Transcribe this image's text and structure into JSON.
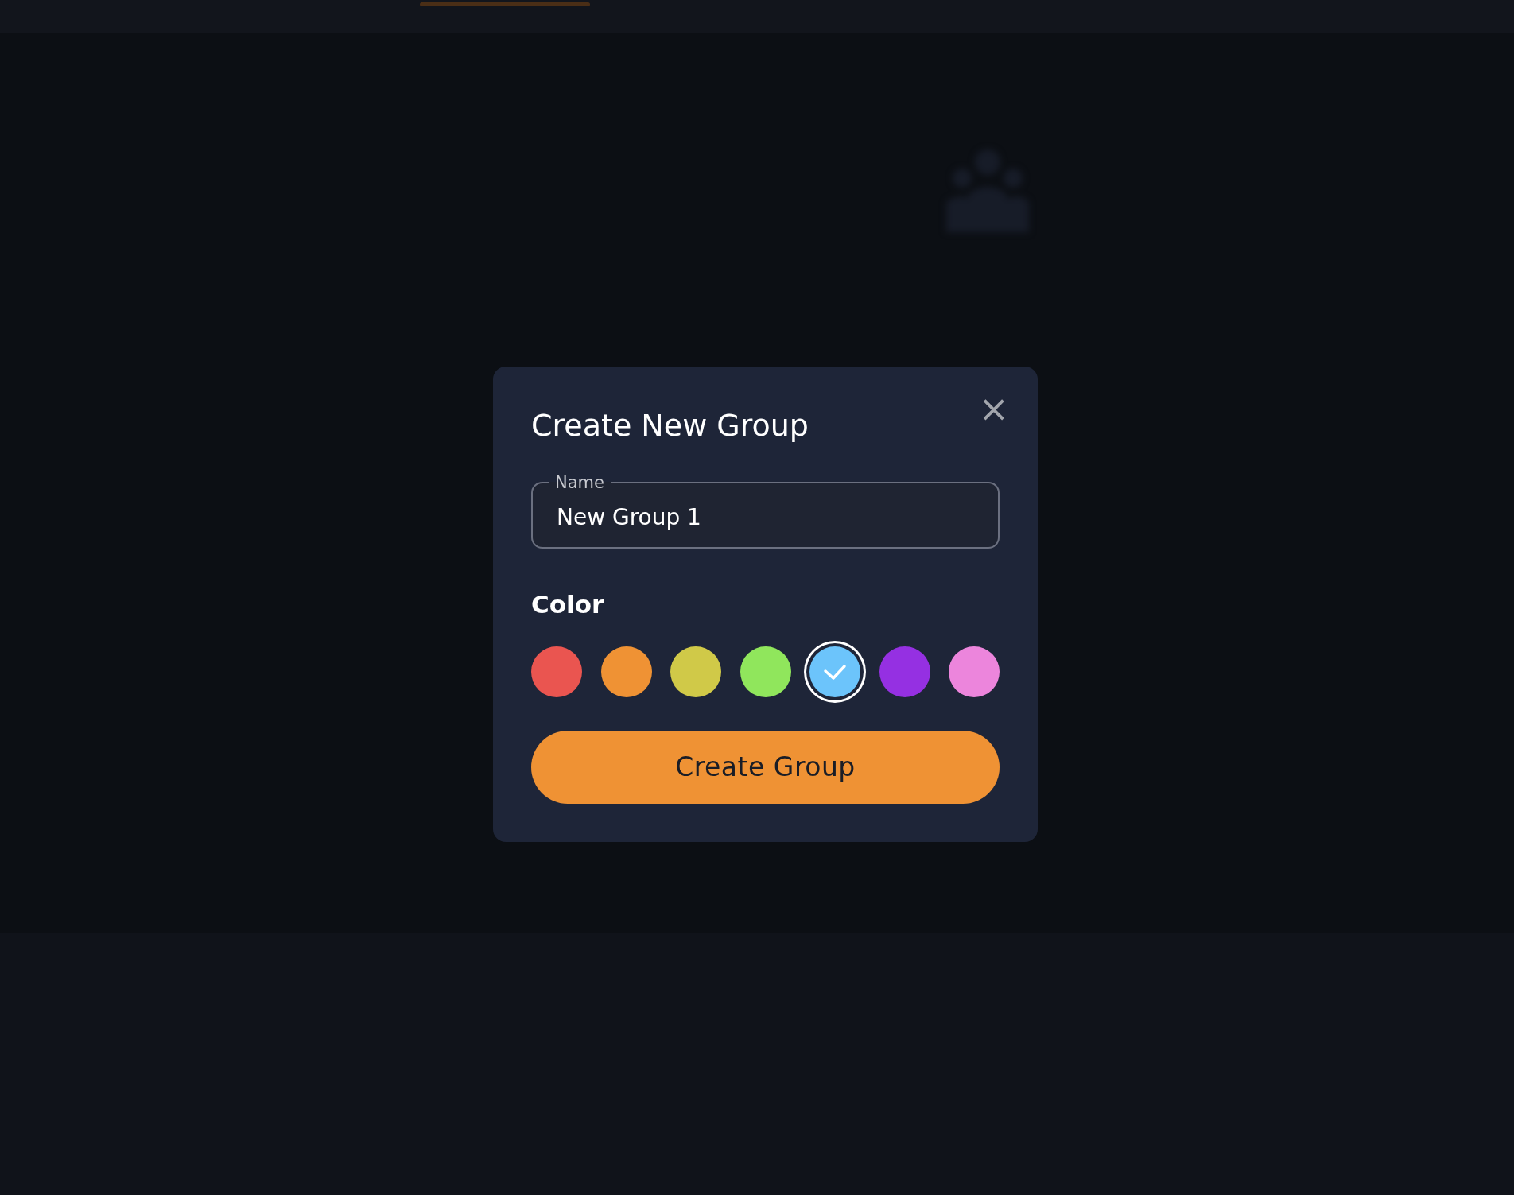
{
  "dialog": {
    "title": "Create New Group",
    "close": "×",
    "name_field": {
      "label": "Name",
      "value": "New Group 1"
    },
    "color_label": "Color",
    "colors": [
      {
        "color": "#ea5550",
        "selected": false
      },
      {
        "color": "#ef9234",
        "selected": false
      },
      {
        "color": "#d0c948",
        "selected": false
      },
      {
        "color": "#90e65c",
        "selected": false
      },
      {
        "color": "#6cc4fb",
        "selected": true
      },
      {
        "color": "#9530e2",
        "selected": false
      },
      {
        "color": "#ec85dc",
        "selected": false
      }
    ],
    "submit": "Create Group"
  }
}
